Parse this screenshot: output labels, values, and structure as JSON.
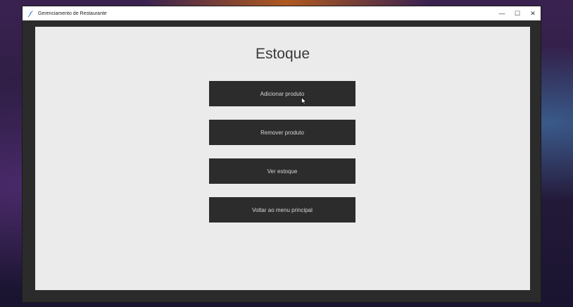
{
  "window": {
    "title": "Gerenciamento de Restaurante",
    "controls": {
      "minimize": "—",
      "maximize": "☐",
      "close": "✕"
    }
  },
  "page": {
    "title": "Estoque"
  },
  "menu": {
    "buttons": [
      {
        "label": "Adicionar produto"
      },
      {
        "label": "Remover produto"
      },
      {
        "label": "Ver estoque"
      },
      {
        "label": "Voltar ao menu principal"
      }
    ]
  },
  "colors": {
    "button_bg": "#2c2c2c",
    "button_text": "#d6d6d6",
    "content_bg": "#ebebeb",
    "frame": "#2b2b2b"
  },
  "icons": {
    "app": "feather-icon",
    "cursor": "mouse-pointer-icon"
  }
}
